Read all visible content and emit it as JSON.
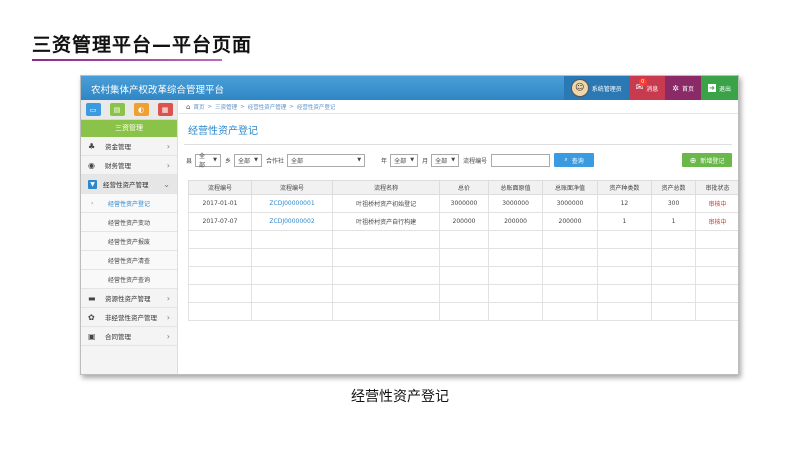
{
  "slide": {
    "title": "三资管理平台—平台页面",
    "caption": "经营性资产登记"
  },
  "app": {
    "title": "农村集体产权改革综合管理平台",
    "topbar": {
      "user": "系统管理员",
      "messages": "消息",
      "message_count": "0",
      "home": "首页",
      "exit": "退出"
    }
  },
  "sidebar": {
    "header": "三资管理",
    "items": [
      {
        "label": "资金管理",
        "icon": "money-icon"
      },
      {
        "label": "财务管理",
        "icon": "finance-icon"
      },
      {
        "label": "经营性资产管理",
        "icon": "asset-icon"
      }
    ],
    "subitems": [
      "经营性资产登记",
      "经营性资产变动",
      "经营性资产报废",
      "经营性资产清查",
      "经营性资产查询"
    ],
    "items_after": [
      {
        "label": "资源性资产管理",
        "icon": "resource-icon"
      },
      {
        "label": "非经营性资产管理",
        "icon": "nonop-icon"
      },
      {
        "label": "合同管理",
        "icon": "contract-icon"
      }
    ]
  },
  "breadcrumb": [
    "首页",
    ">",
    "三资管理",
    ">",
    "经营性资产管理",
    ">",
    "经营性资产登记"
  ],
  "page_title": "经营性资产登记",
  "filters": {
    "county_label": "县",
    "county_value": "全部",
    "town_label": "乡",
    "town_value": "全部",
    "coop_label": "合作社",
    "coop_value": "全部",
    "year_label": "年",
    "year_value": "全部",
    "month_label": "月",
    "month_value": "全部",
    "flow_label": "流程编号",
    "flow_value": "",
    "query_button": "查询",
    "add_button": "新增登记"
  },
  "table": {
    "columns": [
      "流程编号",
      "流程编号",
      "流程名称",
      "总价",
      "总账面原值",
      "总账面净值",
      "资产种类数",
      "资产总数",
      "审批状态"
    ],
    "rows": [
      [
        "2017-01-01",
        "ZCDJ00000001",
        "叶祖桥村资产初始登记",
        "3000000",
        "3000000",
        "3000000",
        "12",
        "300",
        "审核中"
      ],
      [
        "2017-07-07",
        "ZCDJ00000002",
        "叶祖桥村资产自行构建",
        "200000",
        "200000",
        "200000",
        "1",
        "1",
        "审核中"
      ]
    ]
  }
}
